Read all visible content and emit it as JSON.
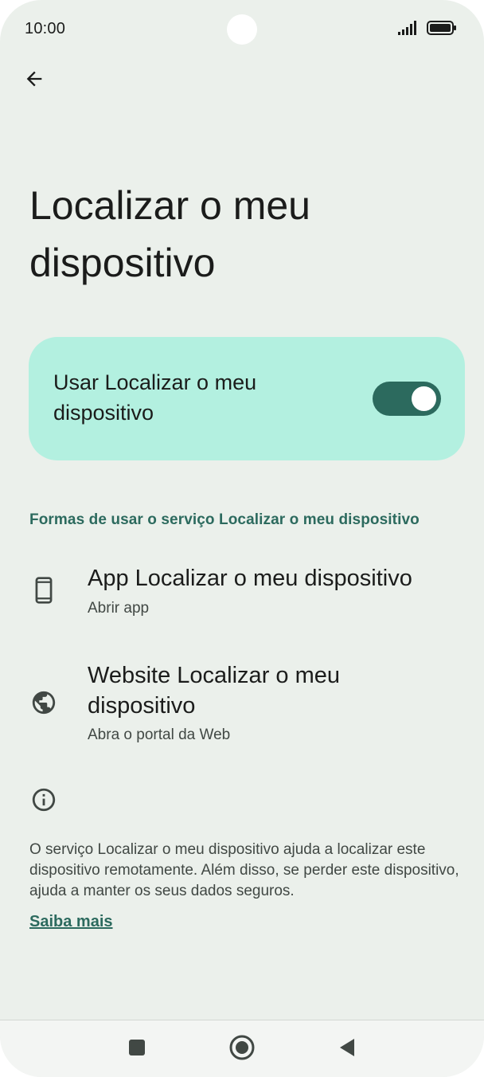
{
  "status_bar": {
    "time": "10:00",
    "signal_icon": "signal-bars-icon",
    "battery_icon": "battery-icon"
  },
  "header": {
    "back_icon": "arrow-back-icon",
    "title": "Localizar o meu dispositivo"
  },
  "master_toggle": {
    "label": "Usar Localizar o meu dispositivo",
    "state": "on",
    "accent": "#2c6a5e",
    "card_color": "#b3f0e0"
  },
  "section": {
    "header": "Formas de usar o serviço Localizar o meu dispositivo",
    "items": [
      {
        "icon": "phone-icon",
        "title": "App Localizar o meu dispositivo",
        "subtitle": "Abrir app"
      },
      {
        "icon": "globe-icon",
        "title": "Website Localizar o meu dispositivo",
        "subtitle": "Abra o portal da Web"
      }
    ]
  },
  "info": {
    "icon": "info-icon",
    "text": "O serviço Localizar o meu dispositivo ajuda a localizar este dispositivo remotamente. Além disso, se perder este dispositivo, ajuda a manter os seus dados seguros.",
    "link": "Saiba mais"
  },
  "nav_bar": {
    "recents_icon": "recents-square-icon",
    "home_icon": "home-circle-icon",
    "back_icon": "back-triangle-icon"
  }
}
